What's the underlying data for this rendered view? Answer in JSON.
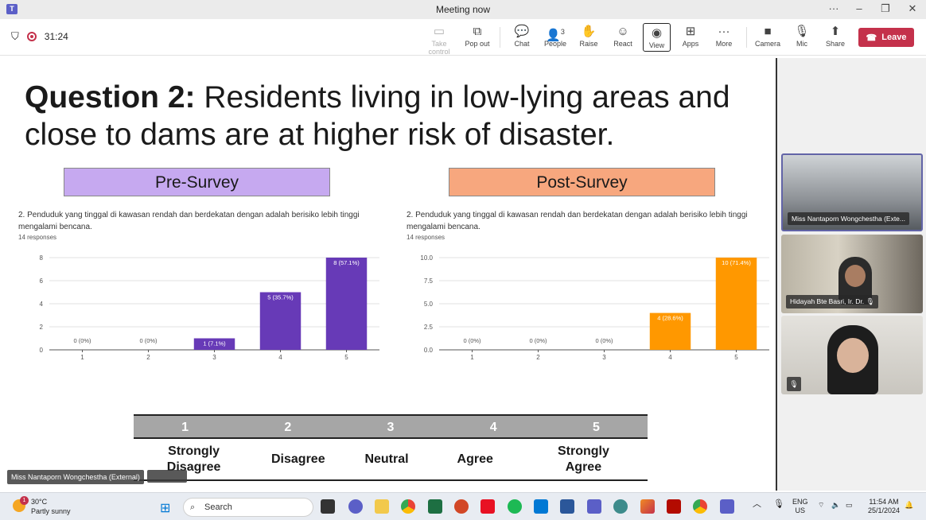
{
  "window": {
    "title": "Meeting now"
  },
  "toolbar": {
    "timer": "31:24",
    "buttons": [
      {
        "label": "Take control",
        "icon": "take-control-icon"
      },
      {
        "label": "Pop out",
        "icon": "pop-out-icon"
      },
      {
        "label": "Chat",
        "icon": "chat-icon"
      },
      {
        "label": "People",
        "icon": "people-icon",
        "badge": "3"
      },
      {
        "label": "Raise",
        "icon": "raise-hand-icon"
      },
      {
        "label": "React",
        "icon": "smiley-icon"
      },
      {
        "label": "View",
        "icon": "view-icon"
      },
      {
        "label": "Apps",
        "icon": "apps-plus-icon"
      },
      {
        "label": "More",
        "icon": "more-dots-icon"
      },
      {
        "label": "Camera",
        "icon": "camera-icon"
      },
      {
        "label": "Mic",
        "icon": "mic-off-icon"
      },
      {
        "label": "Share",
        "icon": "share-icon"
      }
    ],
    "leave_label": "Leave",
    "leave_color": "#c4314b"
  },
  "slide": {
    "title_bold": "Question 2:",
    "title_rest": " Residents living in low-lying areas and close to dams are at higher risk of disaster.",
    "pre_label": "Pre-Survey",
    "post_label": "Post-Survey",
    "pre_color": "#c6a9f0",
    "post_color": "#f7a77e",
    "question_text": "2. Penduduk yang tinggal di kawasan rendah dan berdekatan dengan adalah berisiko lebih tinggi mengalami bencana.",
    "responses": "14 responses",
    "scale": {
      "numbers": [
        "1",
        "2",
        "3",
        "4",
        "5"
      ],
      "labels": [
        "Strongly Disagree",
        "Disagree",
        "Neutral",
        "Agree",
        "Strongly Agree"
      ]
    }
  },
  "chart_data": [
    {
      "type": "bar",
      "categories": [
        "1",
        "2",
        "3",
        "4",
        "5"
      ],
      "values": [
        0,
        0,
        1,
        5,
        8
      ],
      "labels": [
        "0 (0%)",
        "0 (0%)",
        "1 (7.1%)",
        "5 (35.7%)",
        "8 (57.1%)"
      ],
      "yticks": [
        "0",
        "2",
        "4",
        "6",
        "8"
      ],
      "ylim": [
        0,
        8
      ],
      "color": "#673ab7",
      "grid": true
    },
    {
      "type": "bar",
      "categories": [
        "1",
        "2",
        "3",
        "4",
        "5"
      ],
      "values": [
        0,
        0,
        0,
        4,
        10
      ],
      "labels": [
        "0 (0%)",
        "0 (0%)",
        "0 (0%)",
        "4 (28.6%)",
        "10 (71.4%)"
      ],
      "yticks": [
        "0.0",
        "2.5",
        "5.0",
        "7.5",
        "10.0"
      ],
      "ylim": [
        0,
        10
      ],
      "color": "#ff9800",
      "grid": true
    }
  ],
  "presenter": {
    "name": "Miss Nantaporn Wongchestha (External)"
  },
  "gallery": [
    {
      "name": "Miss Nantaporn Wongchestha (Exte..."
    },
    {
      "name": "Hidayah Bte Basri, Ir. Dr."
    },
    {
      "name": ""
    }
  ],
  "taskbar": {
    "weather_temp": "30°C",
    "weather_desc": "Partly sunny",
    "weather_badge": "1",
    "search_label": "Search",
    "lang_top": "ENG",
    "lang_bottom": "US",
    "time": "11:54 AM",
    "date": "25/1/2024"
  }
}
